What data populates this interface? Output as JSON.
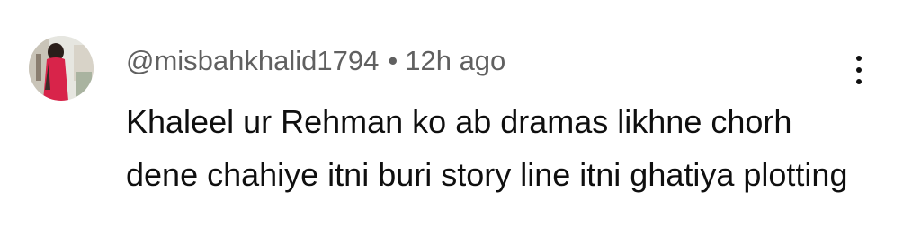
{
  "comment": {
    "handle": "@misbahkhalid1794",
    "separator": "•",
    "time": "12h ago",
    "text": "Khaleel ur Rehman ko ab dramas likhne chorh dene chahiye itni buri story line itni ghatiya plotting"
  },
  "icons": {
    "more": "more-vertical-icon"
  },
  "colors": {
    "meta_text": "#606060",
    "body_text": "#0f0f0f",
    "background": "#ffffff"
  }
}
